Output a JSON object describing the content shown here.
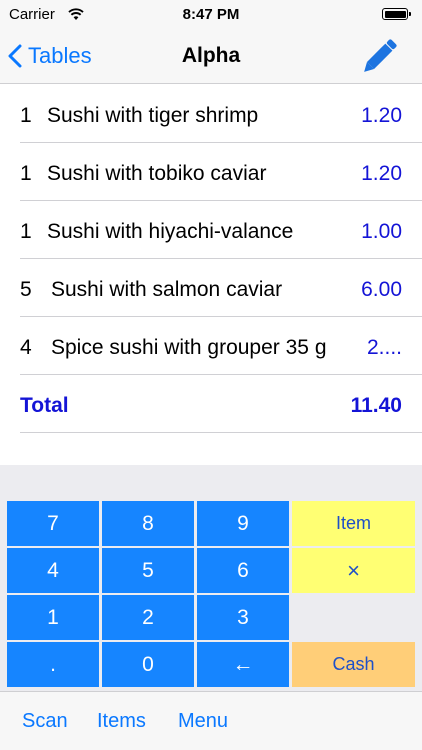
{
  "status_bar": {
    "carrier": "Carrier",
    "time": "8:47 PM"
  },
  "nav": {
    "back_label": "Tables",
    "title": "Alpha"
  },
  "items": [
    {
      "qty": "1",
      "name": "Sushi with tiger shrimp",
      "price": "1.20"
    },
    {
      "qty": "1",
      "name": "Sushi with tobiko caviar",
      "price": "1.20"
    },
    {
      "qty": "1",
      "name": "Sushi with hiyachi-valance",
      "price": "1.00"
    },
    {
      "qty": "5",
      "name": "Sushi with salmon caviar",
      "price": "6.00"
    },
    {
      "qty": "4",
      "name": "Spice sushi with grouper 35 g",
      "price": "2...."
    }
  ],
  "total": {
    "label": "Total",
    "value": "11.40"
  },
  "keypad": {
    "k7": "7",
    "k8": "8",
    "k9": "9",
    "item": "Item",
    "k4": "4",
    "k5": "5",
    "k6": "6",
    "multiply": "×",
    "k1": "1",
    "k2": "2",
    "k3": "3",
    "dot": ".",
    "k0": "0",
    "backspace": "←",
    "cash": "Cash"
  },
  "tabs": {
    "scan": "Scan",
    "items": "Items",
    "menu": "Menu"
  },
  "colors": {
    "accent": "#0a78ff",
    "price_blue": "#1414d6",
    "key_blue": "#1685ff",
    "key_yellow": "#ffff73",
    "key_orange": "#ffce78"
  }
}
